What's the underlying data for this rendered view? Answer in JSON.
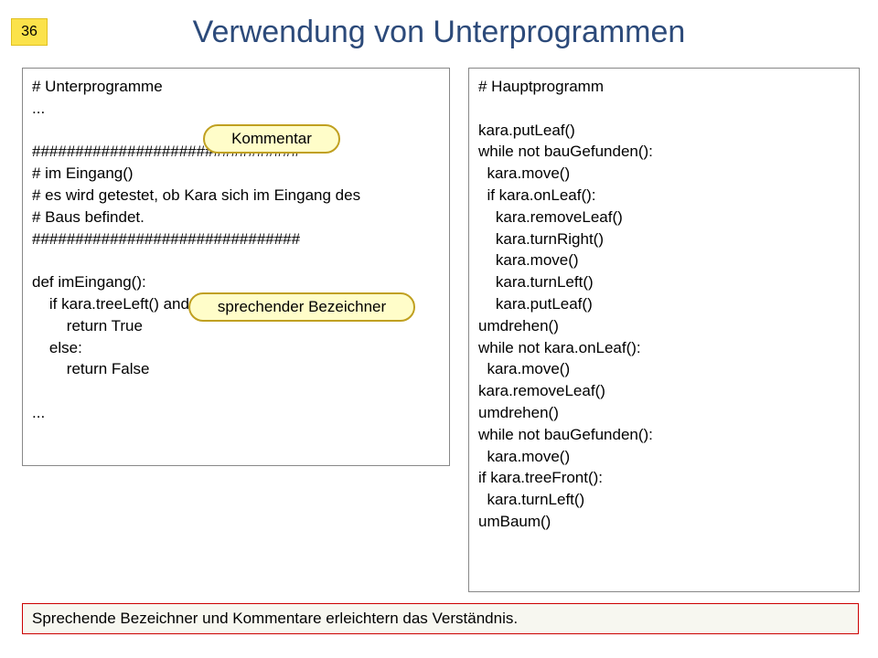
{
  "slide": {
    "number": "36"
  },
  "title": "Verwendung von Unterprogrammen",
  "callouts": {
    "kommentar": "Kommentar",
    "bezeichner": "sprechender Bezeichner"
  },
  "code_left": "# Unterprogramme\n...\n\n###############################\n# im Eingang()\n# es wird getestet, ob Kara sich im Eingang des\n# Baus befindet.\n###############################\n\ndef imEingang():\n    if kara.treeLeft() and kara.treeRight():\n        return True\n    else:\n        return False\n\n...",
  "code_right": "# Hauptprogramm\n\nkara.putLeaf()\nwhile not bauGefunden():\n  kara.move()\n  if kara.onLeaf():\n    kara.removeLeaf()\n    kara.turnRight()\n    kara.move()\n    kara.turnLeft()\n    kara.putLeaf()\numdrehen()\nwhile not kara.onLeaf():\n  kara.move()\nkara.removeLeaf()\numdrehen()\nwhile not bauGefunden():\n  kara.move()\nif kara.treeFront():\n  kara.turnLeft()\numBaum()",
  "footer": "Sprechende Bezeichner und Kommentare erleichtern das Verständnis."
}
